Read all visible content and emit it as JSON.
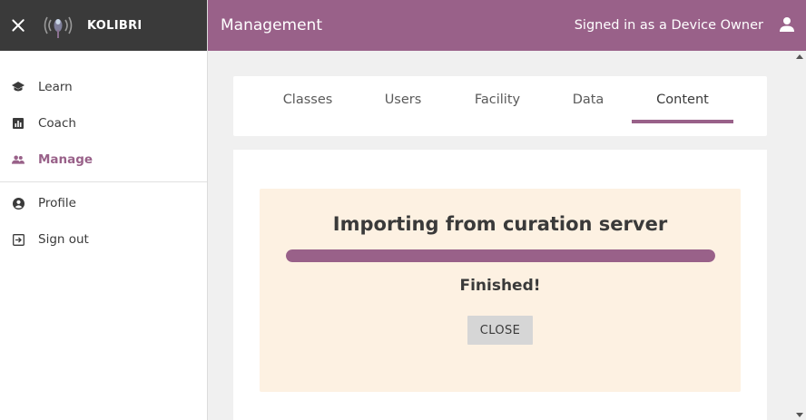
{
  "sidebar": {
    "brand": "KOLIBRI",
    "close_icon": "close-icon",
    "items": [
      {
        "label": "Learn",
        "icon": "learn-icon"
      },
      {
        "label": "Coach",
        "icon": "coach-icon"
      },
      {
        "label": "Manage",
        "icon": "manage-icon"
      },
      {
        "label": "Profile",
        "icon": "profile-icon"
      },
      {
        "label": "Sign out",
        "icon": "sign-out-icon"
      }
    ],
    "active_item": "Manage"
  },
  "appbar": {
    "title": "Management",
    "signed_in_text": "Signed in as a Device Owner",
    "user_icon": "user-icon"
  },
  "tabs": [
    {
      "label": "Classes"
    },
    {
      "label": "Users"
    },
    {
      "label": "Facility"
    },
    {
      "label": "Data"
    },
    {
      "label": "Content"
    }
  ],
  "active_tab": "Content",
  "task": {
    "title": "Importing from curation server",
    "progress_percent": 100,
    "status": "Finished!",
    "close_label": "CLOSE"
  },
  "colors": {
    "primary": "#996189",
    "appbar_bg": "#996189",
    "sidebar_header_bg": "#3a3a3a",
    "panel_bg": "#fdf1e2",
    "page_bg": "#f0f0f0"
  }
}
